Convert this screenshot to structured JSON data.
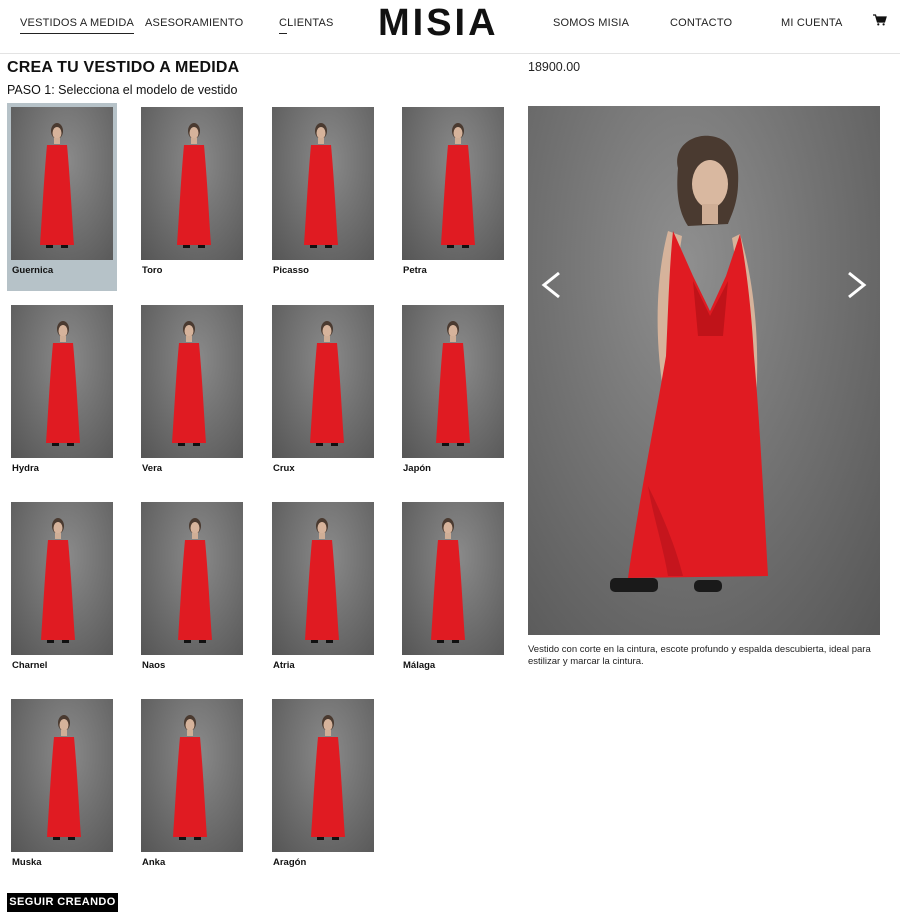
{
  "header": {
    "nav_left": [
      "VESTIDOS A MEDIDA",
      "ASESORAMIENTO",
      "CLIENTAS"
    ],
    "logo": "MISIA",
    "nav_right": [
      "SOMOS MISIA",
      "CONTACTO",
      "MI CUENTA"
    ],
    "cart_icon": "cart-icon"
  },
  "main": {
    "title": "CREA TU VESTIDO A MEDIDA",
    "step": "PASO 1: Selecciona el modelo de vestido",
    "models": [
      {
        "name": "Guernica",
        "selected": true
      },
      {
        "name": "Toro"
      },
      {
        "name": "Picasso"
      },
      {
        "name": "Petra"
      },
      {
        "name": "Hydra"
      },
      {
        "name": "Vera"
      },
      {
        "name": "Crux"
      },
      {
        "name": "Japón"
      },
      {
        "name": "Charnel"
      },
      {
        "name": "Naos"
      },
      {
        "name": "Atria"
      },
      {
        "name": "Málaga"
      },
      {
        "name": "Muska"
      },
      {
        "name": "Anka"
      },
      {
        "name": "Aragón"
      }
    ],
    "cta": "SEGUIR CREANDO"
  },
  "detail": {
    "price": "18900.00",
    "description": "Vestido con corte en la cintura, escote profundo y espalda descubierta, ideal para estilizar y marcar la cintura."
  },
  "colors": {
    "dress_red": "#e01b22",
    "selected_bg": "#b6c2c8",
    "cta_bg": "#000000"
  }
}
